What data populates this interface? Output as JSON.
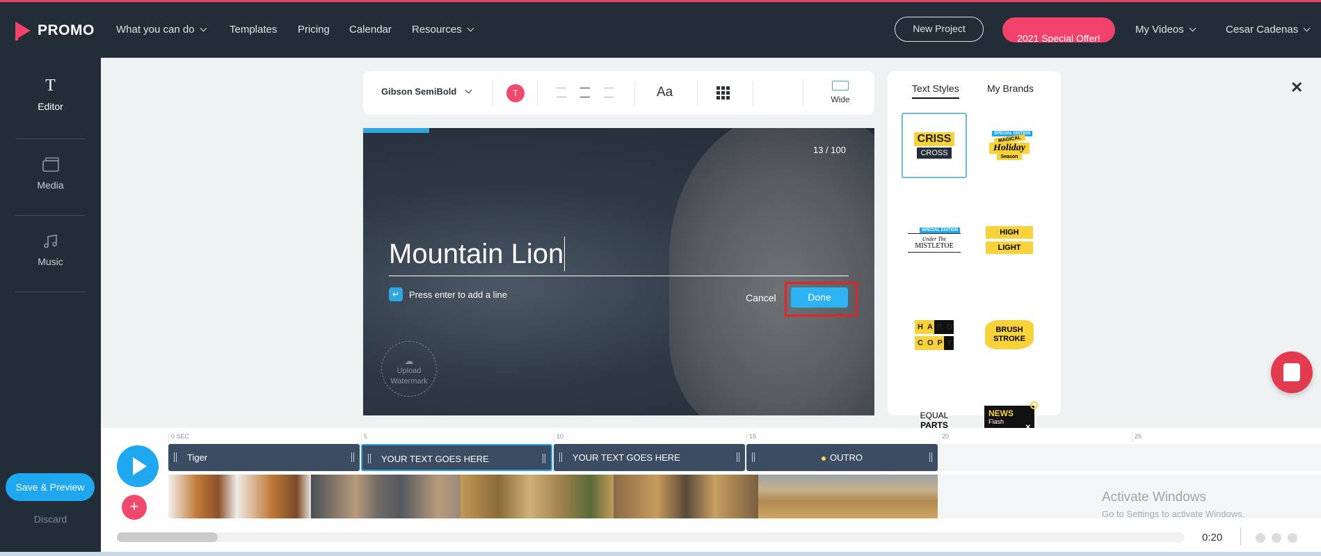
{
  "header": {
    "brand": "PROMO",
    "nav": [
      {
        "label": "What you can do",
        "dropdown": true
      },
      {
        "label": "Templates"
      },
      {
        "label": "Pricing"
      },
      {
        "label": "Calendar"
      },
      {
        "label": "Resources",
        "dropdown": true
      }
    ],
    "new_project": "New Project",
    "offer": "2021 Special Offer!",
    "my_videos": "My Videos",
    "user": "Cesar Cadenas"
  },
  "sidebar": {
    "items": [
      {
        "label": "Editor",
        "icon": "text-icon",
        "active": true
      },
      {
        "label": "Media",
        "icon": "media-icon"
      },
      {
        "label": "Music",
        "icon": "music-icon"
      }
    ],
    "save_preview": "Save & Preview",
    "discard": "Discard"
  },
  "toolbar": {
    "font": "Gibson SemiBold",
    "color_letter": "T",
    "color": "#ef4a6e",
    "size_label": "Aa",
    "ratio_label": "Wide"
  },
  "preview": {
    "char_count": "13 / 100",
    "text": "Mountain Lion",
    "hint": "Press enter to add a line",
    "cancel": "Cancel",
    "done": "Done",
    "watermark": "Upload Watermark",
    "progress_percent": 13
  },
  "panel": {
    "tabs": [
      "Text Styles",
      "My Brands"
    ],
    "active_tab": "Text Styles",
    "styles": [
      {
        "name": "CRISS CROSS",
        "line1": "CRISS",
        "line2": "CROSS",
        "selected": true
      },
      {
        "name": "Magical Holiday Season",
        "badge": "SPECIAL EDITION",
        "line1": "MAGICAL",
        "line2": "Holiday",
        "line3": "Season"
      },
      {
        "name": "Under The Mistletoe",
        "badge": "SPECIAL EDITION",
        "line1": "Under The",
        "line2": "MISTLETOE"
      },
      {
        "name": "HIGH LIGHT",
        "line1": "HIGH",
        "line2": "LIGHT"
      },
      {
        "name": "HARD COPY",
        "line1": "HARD",
        "line2": "COPY"
      },
      {
        "name": "BRUSH STROKE",
        "line1": "BRUSH",
        "line2": "STROKE"
      },
      {
        "name": "EQUAL PARTS",
        "line1": "EQUAL",
        "line2": "PARTS"
      },
      {
        "name": "NEWS Flash",
        "line1": "NEWS",
        "line2": "Flash"
      }
    ]
  },
  "timeline": {
    "ticks": [
      "0 SEC",
      "5",
      "10",
      "15",
      "20",
      "25"
    ],
    "segments": [
      {
        "label": "Tiger"
      },
      {
        "label": "YOUR TEXT GOES HERE",
        "selected": true
      },
      {
        "label": "YOUR TEXT GOES HERE"
      },
      {
        "label": "OUTRO"
      }
    ],
    "duration": "0:20"
  },
  "watermark_os": {
    "line1": "Activate Windows",
    "line2": "Go to Settings to activate Windows."
  },
  "colors": {
    "accent": "#1fa8ef",
    "brand": "#f2416b",
    "header": "#232d38",
    "highlight_box": "#e0262b"
  }
}
